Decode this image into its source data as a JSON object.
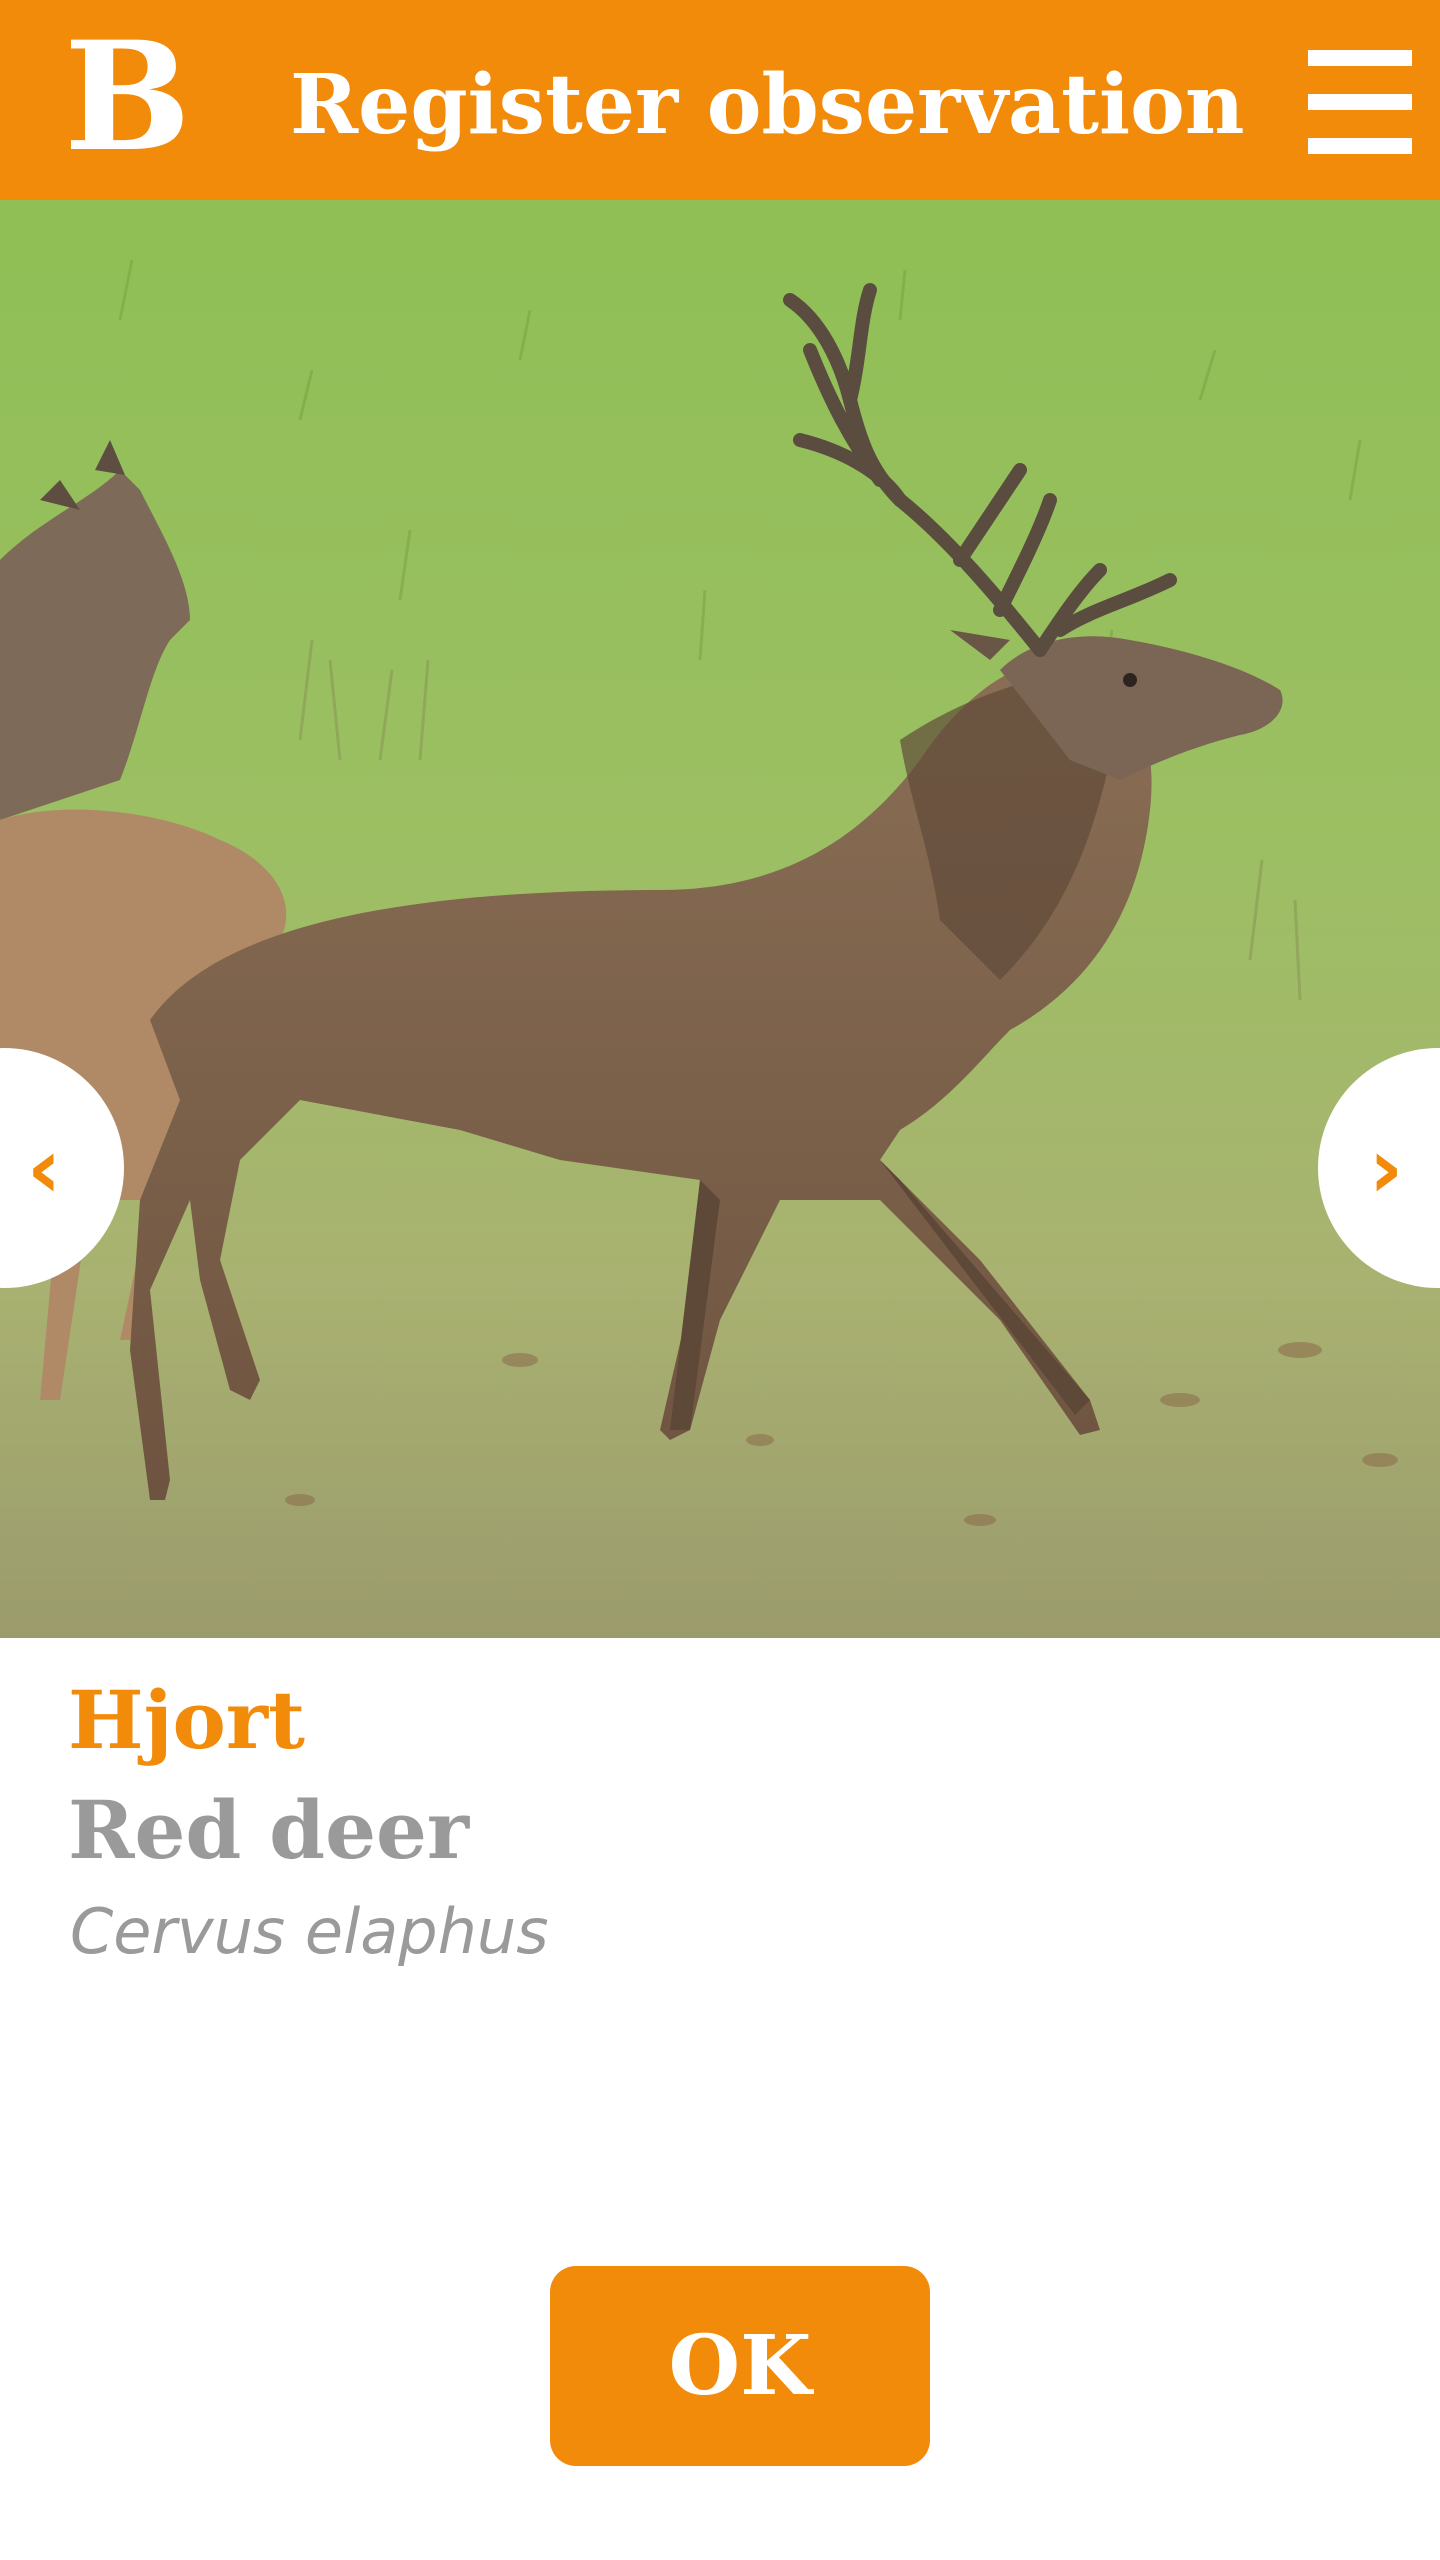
{
  "header": {
    "logo_text": "B",
    "title": "Register observation",
    "menu_icon": "hamburger-menu-icon"
  },
  "photo": {
    "subject": "red-deer-stag-photo",
    "prev_icon": "chevron-left-icon",
    "next_icon": "chevron-right-icon",
    "prev_glyph": "‹",
    "next_glyph": "›"
  },
  "species": {
    "local_name": "Hjort",
    "common_name": "Red deer",
    "latin_name": "Cervus elaphus"
  },
  "actions": {
    "ok_label": "OK"
  },
  "colors": {
    "accent": "#f28a0a",
    "secondary_text": "#9a9a9a"
  }
}
